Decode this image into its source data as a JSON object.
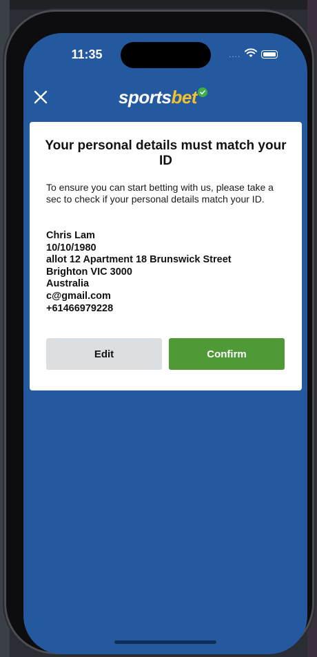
{
  "status_bar": {
    "time": "11:35",
    "signal_dots": "....",
    "wifi_icon": "wifi-icon",
    "battery_icon": "battery-icon"
  },
  "header": {
    "close_icon": "close-icon",
    "logo_part1": "sports",
    "logo_part2": "bet",
    "logo_badge_icon": "check-badge-icon"
  },
  "card": {
    "title": "Your personal details must match your ID",
    "description": "To ensure you can start betting with us, please take a sec to check if your personal details match your ID.",
    "details": {
      "name": "Chris Lam",
      "dob": "10/10/1980",
      "address_line1": "allot 12 Apartment 18 Brunswick Street",
      "address_line2": "Brighton VIC 3000",
      "country": "Australia",
      "email": "c@gmail.com",
      "phone": "+61466979228"
    },
    "edit_label": "Edit",
    "confirm_label": "Confirm"
  },
  "colors": {
    "brand_blue": "#24599f",
    "logo_yellow": "#f2c12e",
    "confirm_green": "#4f9a37",
    "edit_grey": "#dcdfe2"
  }
}
